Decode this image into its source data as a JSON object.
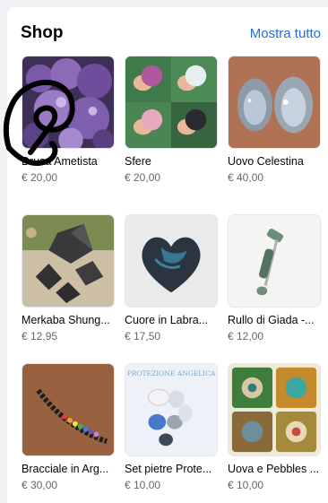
{
  "shop": {
    "title": "Shop",
    "see_all": "Mostra tutto",
    "items": [
      {
        "name": "Drusa Ametista",
        "price": "€ 20,00",
        "icon": "amethyst-druse"
      },
      {
        "name": "Sfere",
        "price": "€ 20,00",
        "icon": "crystal-spheres"
      },
      {
        "name": "Uovo Celestina",
        "price": "€ 40,00",
        "icon": "celestite-egg"
      },
      {
        "name": "Merkaba Shung...",
        "price": "€ 12,95",
        "icon": "merkaba-shungite"
      },
      {
        "name": "Cuore in Labra...",
        "price": "€ 17,50",
        "icon": "labradorite-heart"
      },
      {
        "name": "Rullo di Giada -...",
        "price": "€ 12,00",
        "icon": "jade-roller"
      },
      {
        "name": "Bracciale in Arg...",
        "price": "€ 30,00",
        "icon": "silver-bracelet"
      },
      {
        "name": "Set pietre Prote...",
        "price": "€ 10,00",
        "icon": "protection-stones-set"
      },
      {
        "name": "Uova e Pebbles ...",
        "price": "€ 10,00",
        "icon": "eggs-pebbles"
      }
    ],
    "item8_banner": "PROTEZIONE ANGELICA"
  },
  "colors": {
    "accent": "#216fdb",
    "text": "#050505",
    "muted": "#65676b",
    "page_bg": "#f0f2f5"
  }
}
